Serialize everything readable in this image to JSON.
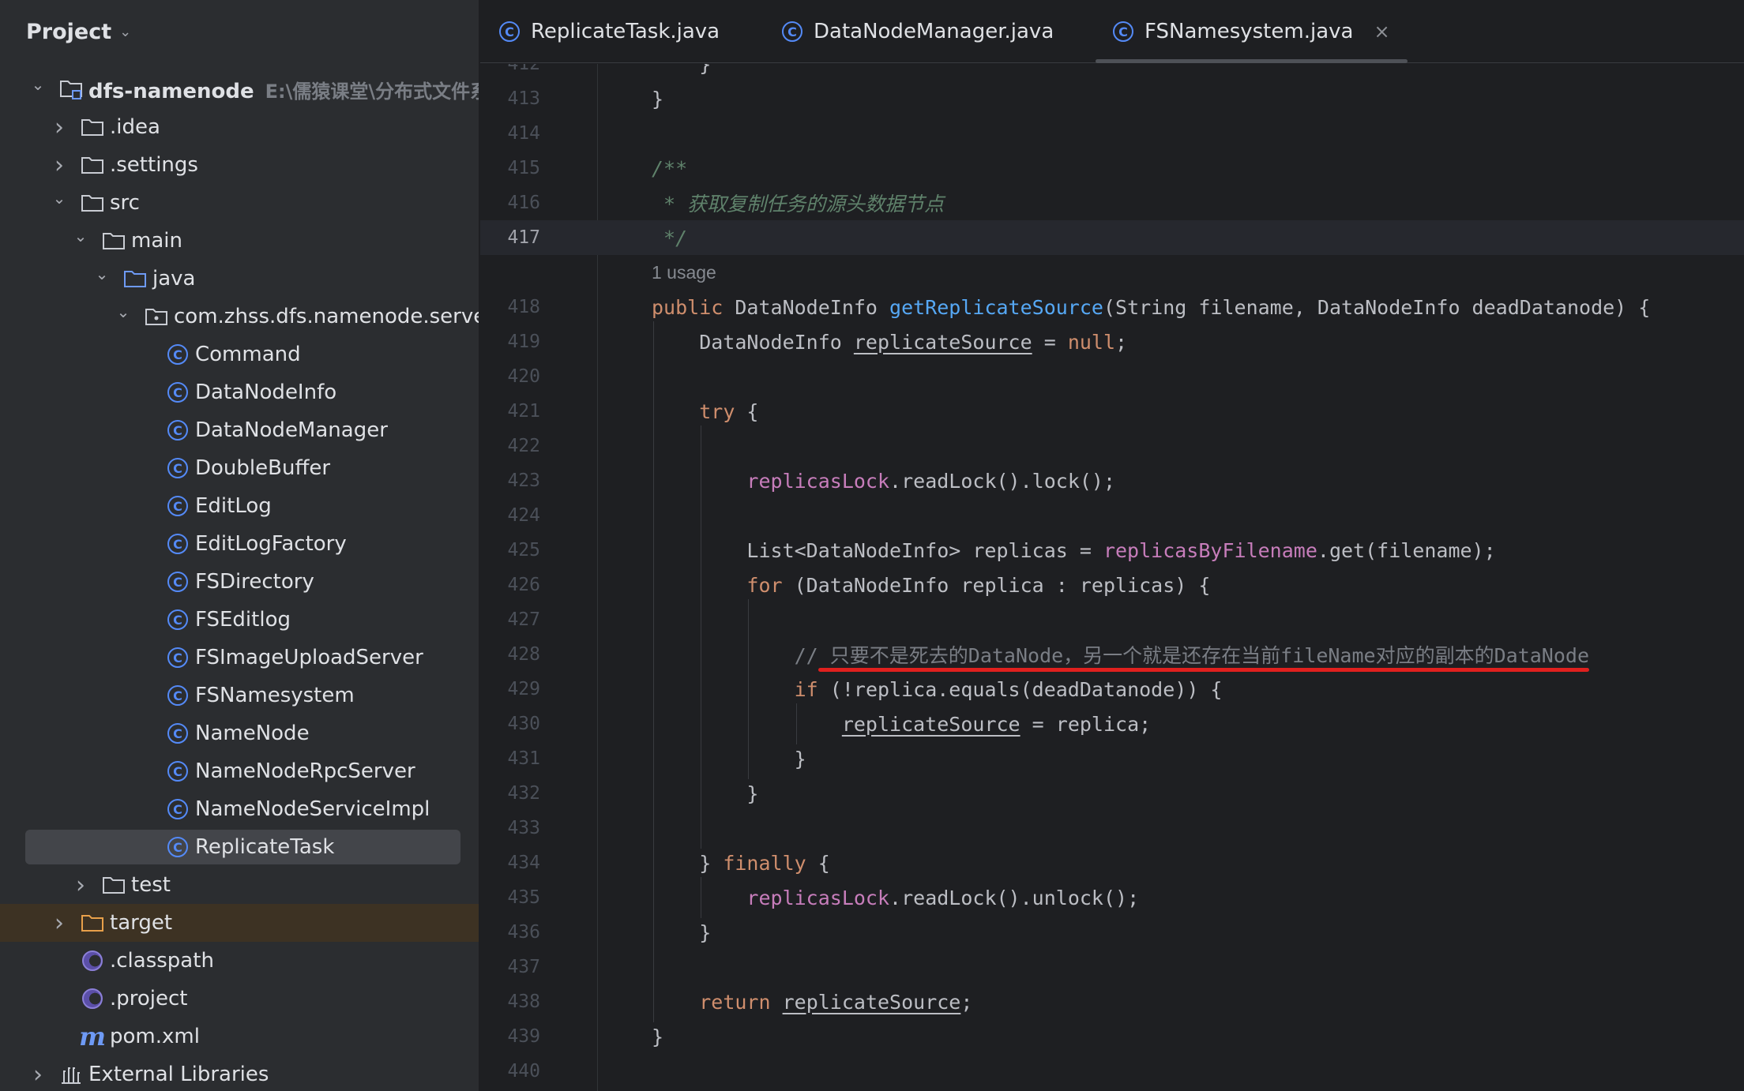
{
  "sidebar": {
    "title": "Project",
    "tree": [
      {
        "label": "dfs-namenode",
        "hint": "E:\\儒猿课堂\\分布式文件系",
        "depth": 0,
        "arrow": "down",
        "icon": "module-folder-icon",
        "bold": true
      },
      {
        "label": ".idea",
        "depth": 1,
        "arrow": "right",
        "icon": "folder-icon"
      },
      {
        "label": ".settings",
        "depth": 1,
        "arrow": "right",
        "icon": "folder-icon"
      },
      {
        "label": "src",
        "depth": 1,
        "arrow": "down",
        "icon": "folder-icon"
      },
      {
        "label": "main",
        "depth": 2,
        "arrow": "down",
        "icon": "folder-icon"
      },
      {
        "label": "java",
        "depth": 3,
        "arrow": "down",
        "icon": "source-folder-icon"
      },
      {
        "label": "com.zhss.dfs.namenode.server",
        "depth": 4,
        "arrow": "down",
        "icon": "package-icon"
      },
      {
        "label": "Command",
        "depth": 5,
        "icon": "class-icon"
      },
      {
        "label": "DataNodeInfo",
        "depth": 5,
        "icon": "class-icon"
      },
      {
        "label": "DataNodeManager",
        "depth": 5,
        "icon": "class-icon"
      },
      {
        "label": "DoubleBuffer",
        "depth": 5,
        "icon": "class-icon"
      },
      {
        "label": "EditLog",
        "depth": 5,
        "icon": "class-icon"
      },
      {
        "label": "EditLogFactory",
        "depth": 5,
        "icon": "class-icon"
      },
      {
        "label": "FSDirectory",
        "depth": 5,
        "icon": "class-icon"
      },
      {
        "label": "FSEditlog",
        "depth": 5,
        "icon": "class-icon"
      },
      {
        "label": "FSImageUploadServer",
        "depth": 5,
        "icon": "class-icon"
      },
      {
        "label": "FSNamesystem",
        "depth": 5,
        "icon": "class-icon"
      },
      {
        "label": "NameNode",
        "depth": 5,
        "icon": "class-icon"
      },
      {
        "label": "NameNodeRpcServer",
        "depth": 5,
        "icon": "class-icon"
      },
      {
        "label": "NameNodeServiceImpl",
        "depth": 5,
        "icon": "class-icon"
      },
      {
        "label": "ReplicateTask",
        "depth": 5,
        "icon": "class-icon",
        "selected": true
      },
      {
        "label": "test",
        "depth": 2,
        "arrow": "right",
        "icon": "folder-icon"
      },
      {
        "label": "target",
        "depth": 1,
        "arrow": "right",
        "icon": "excluded-folder-icon",
        "excluded": true
      },
      {
        "label": ".classpath",
        "depth": 1,
        "icon": "eclipse-icon"
      },
      {
        "label": ".project",
        "depth": 1,
        "icon": "eclipse-icon"
      },
      {
        "label": "pom.xml",
        "depth": 1,
        "icon": "maven-icon"
      },
      {
        "label": "External Libraries",
        "depth": 0,
        "arrow": "right",
        "icon": "library-icon"
      }
    ]
  },
  "tabs": [
    {
      "label": "ReplicateTask.java",
      "active": false
    },
    {
      "label": "DataNodeManager.java",
      "active": false
    },
    {
      "label": "FSNamesystem.java",
      "active": true,
      "close": "×"
    }
  ],
  "editor": {
    "usage_hint": "1 usage",
    "current_line": "417",
    "lines": [
      {
        "n": "412",
        "tokens": [
          {
            "t": "    }",
            "c": ""
          }
        ]
      },
      {
        "n": "413",
        "tokens": [
          {
            "t": "}",
            "c": ""
          }
        ]
      },
      {
        "n": "414",
        "tokens": []
      },
      {
        "n": "415",
        "tokens": [
          {
            "t": "/**",
            "c": "doc"
          }
        ]
      },
      {
        "n": "416",
        "tokens": [
          {
            "t": " * 获取复制任务的源头数据节点",
            "c": "doc"
          }
        ]
      },
      {
        "n": "417",
        "tokens": [
          {
            "t": " */",
            "c": "doc"
          }
        ]
      },
      {
        "usage": true
      },
      {
        "n": "418",
        "tokens": [
          {
            "t": "public ",
            "c": "kw"
          },
          {
            "t": "DataNodeInfo ",
            "c": ""
          },
          {
            "t": "getReplicateSource",
            "c": "fn"
          },
          {
            "t": "(String filename, DataNodeInfo deadDatanode) {",
            "c": ""
          }
        ]
      },
      {
        "n": "419",
        "tokens": [
          {
            "t": "    DataNodeInfo ",
            "c": ""
          },
          {
            "t": "replicateSource",
            "c": "ul"
          },
          {
            "t": " = ",
            "c": ""
          },
          {
            "t": "null",
            "c": "kw"
          },
          {
            "t": ";",
            "c": ""
          }
        ]
      },
      {
        "n": "420",
        "tokens": []
      },
      {
        "n": "421",
        "tokens": [
          {
            "t": "    ",
            "c": ""
          },
          {
            "t": "try",
            "c": "kw"
          },
          {
            "t": " {",
            "c": ""
          }
        ]
      },
      {
        "n": "422",
        "tokens": []
      },
      {
        "n": "423",
        "tokens": [
          {
            "t": "        ",
            "c": ""
          },
          {
            "t": "replicasLock",
            "c": "fld"
          },
          {
            "t": ".readLock().lock();",
            "c": ""
          }
        ]
      },
      {
        "n": "424",
        "tokens": []
      },
      {
        "n": "425",
        "tokens": [
          {
            "t": "        List<DataNodeInfo> replicas = ",
            "c": ""
          },
          {
            "t": "replicasByFilename",
            "c": "fld"
          },
          {
            "t": ".get(filename);",
            "c": ""
          }
        ]
      },
      {
        "n": "426",
        "tokens": [
          {
            "t": "        ",
            "c": ""
          },
          {
            "t": "for",
            "c": "kw"
          },
          {
            "t": " (DataNodeInfo replica : replicas) {",
            "c": ""
          }
        ]
      },
      {
        "n": "427",
        "tokens": []
      },
      {
        "n": "428",
        "tokens": [
          {
            "t": "            // 只要不是死去的DataNode，另一个就是还存在当前fileName对应的副本的DataNode",
            "c": "cmt"
          }
        ]
      },
      {
        "n": "429",
        "tokens": [
          {
            "t": "            ",
            "c": ""
          },
          {
            "t": "if",
            "c": "kw"
          },
          {
            "t": " (!replica.equals(deadDatanode)) {",
            "c": ""
          }
        ]
      },
      {
        "n": "430",
        "tokens": [
          {
            "t": "                ",
            "c": ""
          },
          {
            "t": "replicateSource",
            "c": "ul"
          },
          {
            "t": " = replica;",
            "c": ""
          }
        ]
      },
      {
        "n": "431",
        "tokens": [
          {
            "t": "            }",
            "c": ""
          }
        ]
      },
      {
        "n": "432",
        "tokens": [
          {
            "t": "        }",
            "c": ""
          }
        ]
      },
      {
        "n": "433",
        "tokens": []
      },
      {
        "n": "434",
        "tokens": [
          {
            "t": "    } ",
            "c": ""
          },
          {
            "t": "finally",
            "c": "kw"
          },
          {
            "t": " {",
            "c": ""
          }
        ]
      },
      {
        "n": "435",
        "tokens": [
          {
            "t": "        ",
            "c": ""
          },
          {
            "t": "replicasLock",
            "c": "fld"
          },
          {
            "t": ".readLock().unlock();",
            "c": ""
          }
        ]
      },
      {
        "n": "436",
        "tokens": [
          {
            "t": "    }",
            "c": ""
          }
        ]
      },
      {
        "n": "437",
        "tokens": []
      },
      {
        "n": "438",
        "tokens": [
          {
            "t": "    ",
            "c": ""
          },
          {
            "t": "return",
            "c": "kw"
          },
          {
            "t": " ",
            "c": ""
          },
          {
            "t": "replicateSource",
            "c": "ul"
          },
          {
            "t": ";",
            "c": ""
          }
        ]
      },
      {
        "n": "439",
        "tokens": [
          {
            "t": "}",
            "c": ""
          }
        ]
      },
      {
        "n": "440",
        "tokens": []
      }
    ]
  },
  "colors": {
    "annotation_underline": "#e0201e",
    "class_icon": "#548af7",
    "keyword": "#cf8e6d",
    "method": "#56a8f5",
    "field": "#c77dbb"
  }
}
